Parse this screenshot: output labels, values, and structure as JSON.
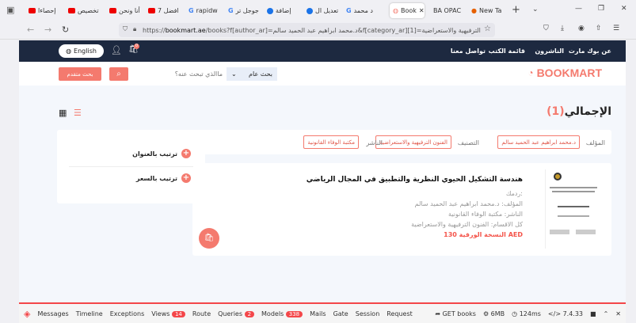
{
  "browser": {
    "tabs": [
      {
        "label": "إحصاءا",
        "icon": "youtube-icon"
      },
      {
        "label": "تخصيص",
        "icon": "youtube-icon"
      },
      {
        "label": "أنا ونحن",
        "icon": "youtube-icon"
      },
      {
        "label": "افضل 7",
        "icon": "youtube-icon"
      },
      {
        "label": "rapidw",
        "icon": "google-icon"
      },
      {
        "label": "جوجل تر",
        "icon": "google-icon"
      },
      {
        "label": "إضافة",
        "icon": "circle-icon"
      },
      {
        "label": "تعديل ال",
        "icon": "circle-icon"
      },
      {
        "label": "د محمد",
        "icon": "google-icon"
      },
      {
        "label": "Book",
        "icon": "bookmart-icon"
      },
      {
        "label": "BA OPAC",
        "icon": ""
      },
      {
        "label": "New Ta",
        "icon": "firefox-icon"
      }
    ],
    "url_prefix": "https://",
    "url_domain": "bookmart.ae",
    "url_rest": "/books?f[author_ar]=د.محمد ابراهيم عبد الحميد سالم&f[category_ar][1]=الترفيهية والاستعراضية"
  },
  "nav": {
    "links": [
      "عن بوك مارت",
      "الناشرون",
      "قائمة الكتب",
      "تواصل معنا"
    ],
    "language": "English",
    "cart_count": "0"
  },
  "header": {
    "logo": "BOOKMART",
    "search_type": "بحث عام",
    "search_placeholder": "ماالذي تبحث عنه؟",
    "advanced_search": "بحث متقدم"
  },
  "main": {
    "total_label": "الإجمالي",
    "total_count": "(1)",
    "filters": {
      "author_label": "المؤلف",
      "author": "د.محمد ابراهيم عبد الحميد سالم",
      "category_label": "التصنيف",
      "category": "الفنون الترفيهية والاستعراضية",
      "publisher_label": "الناشر",
      "publisher": "مكتبة الوفاء القانونية"
    },
    "book": {
      "title": "هندسة التشكيل الحيوي النظرية والتطبيق في المجال الرياضي",
      "isbn": "ردمك:",
      "author": "المؤلف: د.محمد ابراهيم عبد الحميد سالم",
      "publisher": "الناشر: مكتبة الوفاء القانونية",
      "category": "كل الاقسام: الفنون الترفيهية والاستعراضية",
      "price": "النسخة الورقية 130 AED"
    },
    "sort": [
      "ترتيب بالعنوان",
      "ترتيب بالسعر"
    ]
  },
  "debugbar": {
    "items": [
      "Messages",
      "Timeline",
      "Exceptions",
      "Views",
      "Route",
      "Queries",
      "Models",
      "Mails",
      "Gate",
      "Session",
      "Request"
    ],
    "views_count": "14",
    "queries_count": "2",
    "models_count": "338",
    "route": "GET books",
    "memory": "6MB",
    "time": "124ms",
    "php": "7.4.33"
  }
}
